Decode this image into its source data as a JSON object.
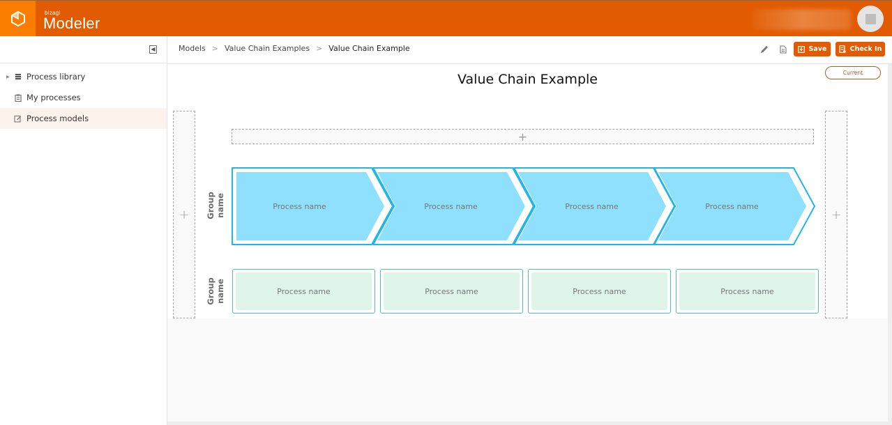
{
  "app": {
    "brand_small": "bizagi",
    "brand_name": "Modeler"
  },
  "colors": {
    "brand": "#e25b00",
    "brand_light": "#fb7d00",
    "chevron_fill": "#8fe0fd",
    "chevron_border": "#1fb6ea",
    "box_fill": "#dff5ea",
    "box_border": "#4cc79b"
  },
  "sidebar": {
    "items": [
      {
        "label": "Process library",
        "icon": "database-icon",
        "expandable": true,
        "active": false
      },
      {
        "label": "My processes",
        "icon": "clipboard-icon",
        "expandable": false,
        "active": false
      },
      {
        "label": "Process models",
        "icon": "edit-document-icon",
        "expandable": false,
        "active": true
      }
    ]
  },
  "breadcrumb": {
    "items": [
      "Models",
      "Value Chain Examples",
      "Value Chain Example"
    ],
    "separator": ">"
  },
  "toolbar": {
    "save_label": "Save",
    "checkin_label": "Check In"
  },
  "canvas": {
    "title": "Value Chain Example",
    "version_badge": "Current",
    "add_symbol": "+",
    "groups": [
      {
        "label_line1": "Group",
        "label_line2": "name",
        "type": "chevron",
        "processes": [
          "Process name",
          "Process name",
          "Process name",
          "Process name"
        ]
      },
      {
        "label_line1": "Group",
        "label_line2": "name",
        "type": "box",
        "processes": [
          "Process name",
          "Process name",
          "Process name",
          "Process name"
        ]
      }
    ]
  }
}
